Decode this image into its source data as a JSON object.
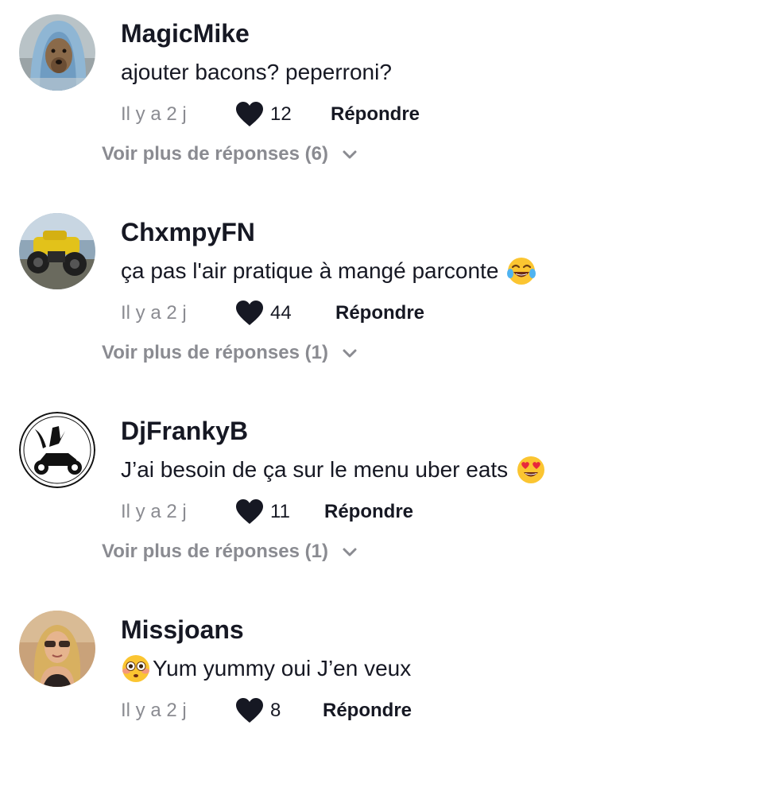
{
  "colors": {
    "text_primary": "#161823",
    "text_secondary": "#8a8b91",
    "heart": "#161823",
    "background": "#ffffff"
  },
  "icons": {
    "like": "heart-icon",
    "expand": "chevron-down-icon"
  },
  "comments": [
    {
      "username": "MagicMike",
      "text": "ajouter bacons? peperroni?",
      "emoji": "",
      "time": "Il y a 2 j",
      "likes": "12",
      "reply_label": "Répondre",
      "more_replies": "Voir plus de réponses (6)"
    },
    {
      "username": "ChxmpyFN",
      "text": "ça pas l'air pratique à mangé parconte",
      "emoji": "face-with-tears-of-joy",
      "time": "Il y a 2 j",
      "likes": "44",
      "reply_label": "Répondre",
      "more_replies": "Voir plus de réponses (1)"
    },
    {
      "username": "DjFrankyB",
      "text": "J’ai besoin de ça sur le menu uber eats",
      "emoji": "smiling-face-with-heart-eyes",
      "time": "Il y a 2 j",
      "likes": "11",
      "reply_label": "Répondre",
      "more_replies": "Voir plus de réponses (1)"
    },
    {
      "username": "Missjoans",
      "text": "Yum yummy oui J’en veux",
      "emoji": "flushed-face",
      "time": "Il y a 2 j",
      "likes": "8",
      "reply_label": "Répondre"
    }
  ]
}
